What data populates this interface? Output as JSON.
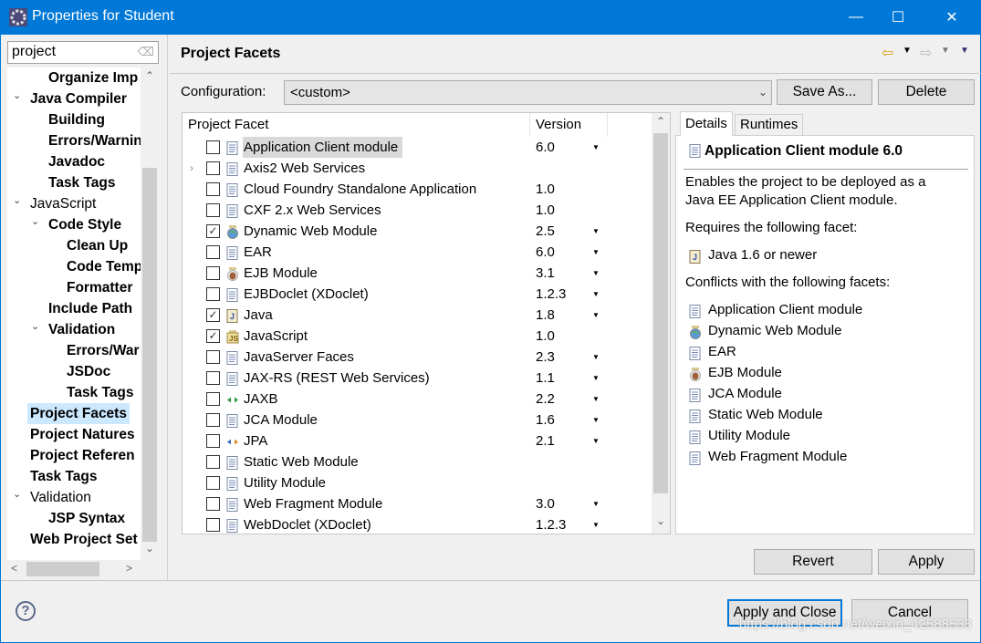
{
  "window": {
    "title": "Properties for Student",
    "minimize": "—",
    "maximize": "☐",
    "close": "✕"
  },
  "search": {
    "value": "project"
  },
  "tree": [
    {
      "label": "Organize Imp",
      "level": 2,
      "bold": true
    },
    {
      "label": "Java Compiler",
      "level": 1,
      "bold": true,
      "expanded": true
    },
    {
      "label": "Building",
      "level": 2,
      "bold": true
    },
    {
      "label": "Errors/Warnin",
      "level": 2,
      "bold": true
    },
    {
      "label": "Javadoc",
      "level": 2,
      "bold": true
    },
    {
      "label": "Task Tags",
      "level": 2,
      "bold": true
    },
    {
      "label": "JavaScript",
      "level": 1,
      "bold": false,
      "expanded": true
    },
    {
      "label": "Code Style",
      "level": 2,
      "bold": true,
      "expanded": true
    },
    {
      "label": "Clean Up",
      "level": 3,
      "bold": true
    },
    {
      "label": "Code Temp",
      "level": 3,
      "bold": true
    },
    {
      "label": "Formatter",
      "level": 3,
      "bold": true
    },
    {
      "label": "Include Path",
      "level": 2,
      "bold": true
    },
    {
      "label": "Validation",
      "level": 2,
      "bold": true,
      "expanded": true
    },
    {
      "label": "Errors/War",
      "level": 3,
      "bold": true
    },
    {
      "label": "JSDoc",
      "level": 3,
      "bold": true
    },
    {
      "label": "Task Tags",
      "level": 3,
      "bold": true
    },
    {
      "label": "Project Facets",
      "level": 1,
      "bold": true,
      "selected": true
    },
    {
      "label": "Project Natures",
      "level": 1,
      "bold": true
    },
    {
      "label": "Project Referen",
      "level": 1,
      "bold": true
    },
    {
      "label": "Task Tags",
      "level": 1,
      "bold": true
    },
    {
      "label": "Validation",
      "level": 1,
      "bold": false,
      "expanded": true
    },
    {
      "label": "JSP Syntax",
      "level": 2,
      "bold": true
    },
    {
      "label": "Web Project Set",
      "level": 1,
      "bold": true
    }
  ],
  "header": {
    "title": "Project Facets"
  },
  "config": {
    "label": "Configuration:",
    "value": "<custom>",
    "save_as": "Save As...",
    "delete": "Delete"
  },
  "table": {
    "col_facet": "Project Facet",
    "col_version": "Version",
    "rows": [
      {
        "name": "Application Client module",
        "version": "6.0",
        "dropdown": true,
        "checked": false,
        "icon": "doc",
        "highlight": true
      },
      {
        "name": "Axis2 Web Services",
        "version": "",
        "dropdown": false,
        "checked": false,
        "icon": "doc",
        "expander": true
      },
      {
        "name": "Cloud Foundry Standalone Application",
        "version": "1.0",
        "dropdown": false,
        "checked": false,
        "icon": "doc"
      },
      {
        "name": "CXF 2.x Web Services",
        "version": "1.0",
        "dropdown": false,
        "checked": false,
        "icon": "doc"
      },
      {
        "name": "Dynamic Web Module",
        "version": "2.5",
        "dropdown": true,
        "checked": true,
        "icon": "globe"
      },
      {
        "name": "EAR",
        "version": "6.0",
        "dropdown": true,
        "checked": false,
        "icon": "doc"
      },
      {
        "name": "EJB Module",
        "version": "3.1",
        "dropdown": true,
        "checked": false,
        "icon": "bean"
      },
      {
        "name": "EJBDoclet (XDoclet)",
        "version": "1.2.3",
        "dropdown": true,
        "checked": false,
        "icon": "doc"
      },
      {
        "name": "Java",
        "version": "1.8",
        "dropdown": true,
        "checked": true,
        "icon": "java"
      },
      {
        "name": "JavaScript",
        "version": "1.0",
        "dropdown": false,
        "checked": true,
        "icon": "js"
      },
      {
        "name": "JavaServer Faces",
        "version": "2.3",
        "dropdown": true,
        "checked": false,
        "icon": "doc"
      },
      {
        "name": "JAX-RS (REST Web Services)",
        "version": "1.1",
        "dropdown": true,
        "checked": false,
        "icon": "doc"
      },
      {
        "name": "JAXB",
        "version": "2.2",
        "dropdown": true,
        "checked": false,
        "icon": "arrows-green"
      },
      {
        "name": "JCA Module",
        "version": "1.6",
        "dropdown": true,
        "checked": false,
        "icon": "doc"
      },
      {
        "name": "JPA",
        "version": "2.1",
        "dropdown": true,
        "checked": false,
        "icon": "arrows-orange"
      },
      {
        "name": "Static Web Module",
        "version": "",
        "dropdown": false,
        "checked": false,
        "icon": "doc"
      },
      {
        "name": "Utility Module",
        "version": "",
        "dropdown": false,
        "checked": false,
        "icon": "doc"
      },
      {
        "name": "Web Fragment Module",
        "version": "3.0",
        "dropdown": true,
        "checked": false,
        "icon": "doc"
      },
      {
        "name": "WebDoclet (XDoclet)",
        "version": "1.2.3",
        "dropdown": true,
        "checked": false,
        "icon": "doc"
      }
    ]
  },
  "details": {
    "tab_details": "Details",
    "tab_runtimes": "Runtimes",
    "title": "Application Client module 6.0",
    "desc1": "Enables the project to be deployed as a",
    "desc2": "Java EE Application Client module.",
    "requires_label": "Requires the following facet:",
    "requires": [
      {
        "name": "Java 1.6 or newer",
        "icon": "java"
      }
    ],
    "conflicts_label": "Conflicts with the following facets:",
    "conflicts": [
      {
        "name": "Application Client module",
        "icon": "doc"
      },
      {
        "name": "Dynamic Web Module",
        "icon": "globe"
      },
      {
        "name": "EAR",
        "icon": "doc"
      },
      {
        "name": "EJB Module",
        "icon": "bean"
      },
      {
        "name": "JCA Module",
        "icon": "doc"
      },
      {
        "name": "Static Web Module",
        "icon": "doc"
      },
      {
        "name": "Utility Module",
        "icon": "doc"
      },
      {
        "name": "Web Fragment Module",
        "icon": "doc"
      }
    ]
  },
  "buttons": {
    "revert": "Revert",
    "apply": "Apply",
    "apply_close": "Apply and Close",
    "cancel": "Cancel",
    "help": "?"
  },
  "watermark": "https://blog.csdn.net/weixin_42588533",
  "colors": {
    "titlebar": "#0078d7",
    "selection": "#cce8ff",
    "default_button_border": "#0078d7"
  }
}
